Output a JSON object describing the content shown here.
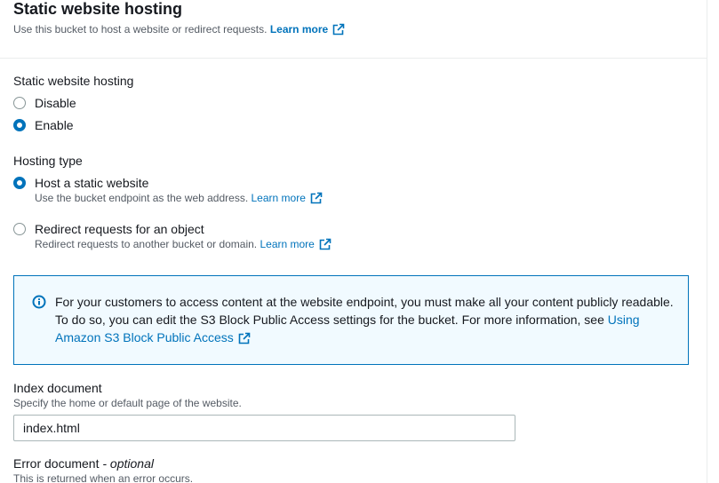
{
  "header": {
    "title": "Static website hosting",
    "subtitle": "Use this bucket to host a website or redirect requests.",
    "learn_more": "Learn more"
  },
  "hosting": {
    "label": "Static website hosting",
    "options": [
      {
        "label": "Disable",
        "selected": false
      },
      {
        "label": "Enable",
        "selected": true
      }
    ]
  },
  "hosting_type": {
    "label": "Hosting type",
    "options": [
      {
        "label": "Host a static website",
        "description": "Use the bucket endpoint as the web address.",
        "learn_more": "Learn more",
        "selected": true
      },
      {
        "label": "Redirect requests for an object",
        "description": "Redirect requests to another bucket or domain.",
        "learn_more": "Learn more",
        "selected": false
      }
    ]
  },
  "info": {
    "text": "For your customers to access content at the website endpoint, you must make all your content publicly readable. To do so, you can edit the S3 Block Public Access settings for the bucket. For more information, see",
    "link": "Using Amazon S3 Block Public Access"
  },
  "index_document": {
    "label": "Index document",
    "description": "Specify the home or default page of the website.",
    "value": "index.html"
  },
  "error_document": {
    "label": "Error document",
    "optional": "- optional",
    "description": "This is returned when an error occurs."
  },
  "colors": {
    "link": "#0073bb",
    "info_border": "#0073bb",
    "info_background": "#f1faff",
    "text": "#16191f",
    "muted": "#545b64"
  }
}
